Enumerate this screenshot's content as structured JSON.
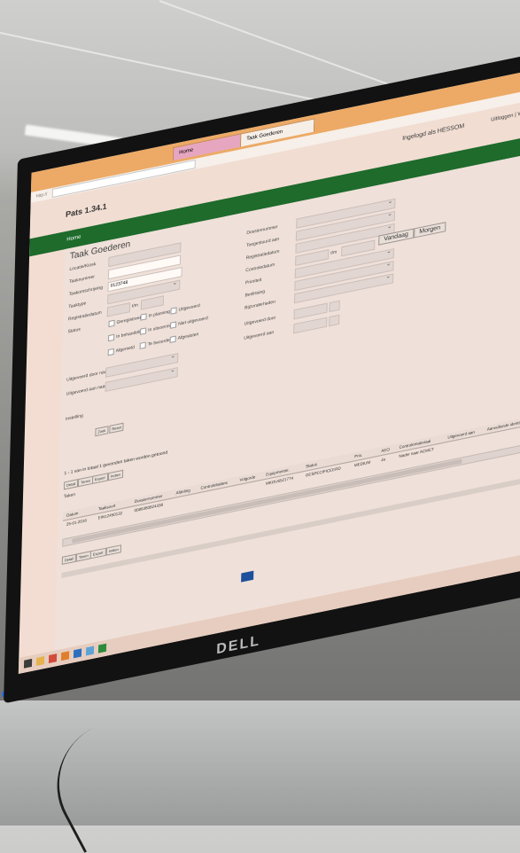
{
  "browser": {
    "tabs": [
      "Home",
      "Taak Goederen"
    ],
    "address": "http://"
  },
  "app": {
    "title": "Pats 1.34.1",
    "logged_in_as": "Ingelogd als HESSOM",
    "header_links": "Uitloggen | Wijzig wachtwoord",
    "nav_home": "Home",
    "page_heading": "Taak Goederen"
  },
  "form": {
    "labels_left": [
      "Locatie/Kiosk",
      "Taaknummer",
      "Taakomschrijving",
      "Taaktype",
      "Registratiedatum",
      "Status",
      "Uitgevoerd door naam",
      "Uitgevoerd aan naam"
    ],
    "taakomschrijving_value": "0123748",
    "status_options": [
      "Geregistreerd",
      "In planning",
      "Uitgevoerd",
      "In behandeling",
      "In uitvoering",
      "Niet uitgevoerd",
      "Afgemeld",
      "Te beoordelen",
      "Afgesloten"
    ],
    "labels_right": [
      "Dossiernummer",
      "Toegestuurd aan",
      "Registratiedatum",
      "Controledatum",
      "Prioriteit",
      "Beslissing",
      "Bijzonderheden",
      "Uitgevoerd door",
      "Uitgevoerd aan"
    ],
    "date_separator": "t/m",
    "today_button": "Vandaag",
    "tomorrow_button": "Morgen",
    "options_toggle": "Instelling",
    "search_button": "Zoek",
    "reset_button": "Reset"
  },
  "results": {
    "summary": "1 - 1 van in totaal 1 gevonden taken worden getoond",
    "action_buttons": [
      "Detail",
      "Tonen",
      "Export",
      "Indien"
    ],
    "action_label": "Taken",
    "columns": [
      "Datum",
      "Taaksoort",
      "Dossiernummer",
      "Afdeling",
      "Controlebalans",
      "Volgorde",
      "Equipmentnr.",
      "Status",
      "Prio.",
      "AEO",
      "Controlemateriaal",
      "Uitgevoerd aan",
      "Aanvullende identificatie"
    ],
    "rows": [
      [
        "25-01-2016",
        "EIN12450132",
        "0086380824338",
        "",
        "",
        "",
        "MKOU6521774",
        "GESPECIFICEERD",
        "MEDIUM",
        "Ja",
        "Nader naar ACMCT",
        "",
        ""
      ]
    ]
  },
  "monitor": {
    "brand": "DELL"
  }
}
